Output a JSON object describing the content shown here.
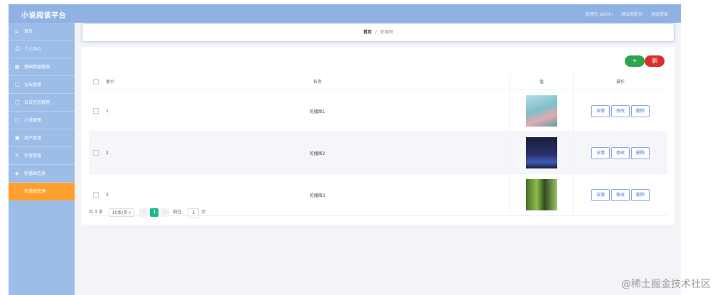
{
  "header": {
    "brand": "小说阅读平台",
    "user": "管理员 admin",
    "link_front": "退出到前台",
    "link_logout": "退出登录"
  },
  "sidebar": {
    "items": [
      {
        "label": "首页",
        "icon": "home-icon"
      },
      {
        "label": "个人中心",
        "icon": "user-icon"
      },
      {
        "label": "基础数据管理",
        "icon": "grid-icon"
      },
      {
        "label": "论坛管理",
        "icon": "chat-icon"
      },
      {
        "label": "公告信息管理",
        "icon": "notice-icon"
      },
      {
        "label": "小说管理",
        "icon": "book-icon"
      },
      {
        "label": "用户管理",
        "icon": "users-icon"
      },
      {
        "label": "作者管理",
        "icon": "pen-icon"
      },
      {
        "label": "轮播图信息",
        "icon": "image-icon"
      },
      {
        "label": "轮播图管理",
        "icon": "slides-icon",
        "active": true
      }
    ]
  },
  "breadcrumb": {
    "home": "首页",
    "separator": "/",
    "current": "轮播图"
  },
  "toolbar": {
    "add_label": "+",
    "delete_label": "删"
  },
  "table": {
    "columns": {
      "index": "索引",
      "name": "名称",
      "image": "值",
      "actions": "操作"
    },
    "rows": [
      {
        "index": "1",
        "name": "轮播图1",
        "image_icon": "carousel-image-1"
      },
      {
        "index": "2",
        "name": "轮播图2",
        "image_icon": "carousel-image-2"
      },
      {
        "index": "3",
        "name": "轮播图3",
        "image_icon": "carousel-image-3"
      }
    ],
    "actions": {
      "detail": "详情",
      "edit": "修改",
      "delete": "删除"
    }
  },
  "pagination": {
    "total": "共 3 条",
    "page_size": "10条/页",
    "prev": "‹",
    "current": "1",
    "next": "›",
    "goto_label": "前往",
    "goto_value": "1",
    "page_suffix": "页"
  },
  "watermark": "@稀土掘金技术社区",
  "colors": {
    "header": "#8fb2e3",
    "sidebar": "#9dbde9",
    "active_menu": "#ff9f2e",
    "add_button": "#2ea44f",
    "delete_button": "#d9302c",
    "pager_active": "#19b88a"
  }
}
